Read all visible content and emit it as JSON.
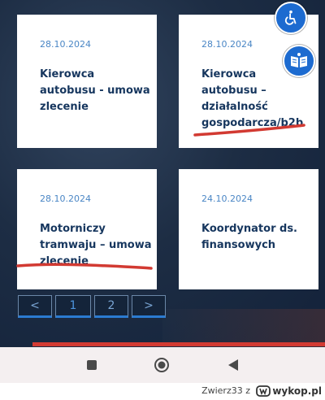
{
  "cards": [
    {
      "date": "28.10.2024",
      "title": "Kierowca autobusu - umowa zlecenie"
    },
    {
      "date": "28.10.2024",
      "title": "Kierowca autobusu – działalność gospodarcza/b2b"
    },
    {
      "date": "28.10.2024",
      "title": "Motorniczy tramwaju – umowa zlecenie"
    },
    {
      "date": "24.10.2024",
      "title": "Koordynator ds. finansowych"
    }
  ],
  "pagination": {
    "prev": "<",
    "pages": [
      "1",
      "2"
    ],
    "next": ">"
  },
  "footer": {
    "author": "Zwierz33 z",
    "logo": "wykop.pl"
  },
  "colors": {
    "card_title": "#16365e",
    "date": "#4a86c5",
    "accent": "#2b7bd1",
    "highlight": "#d23a32"
  }
}
